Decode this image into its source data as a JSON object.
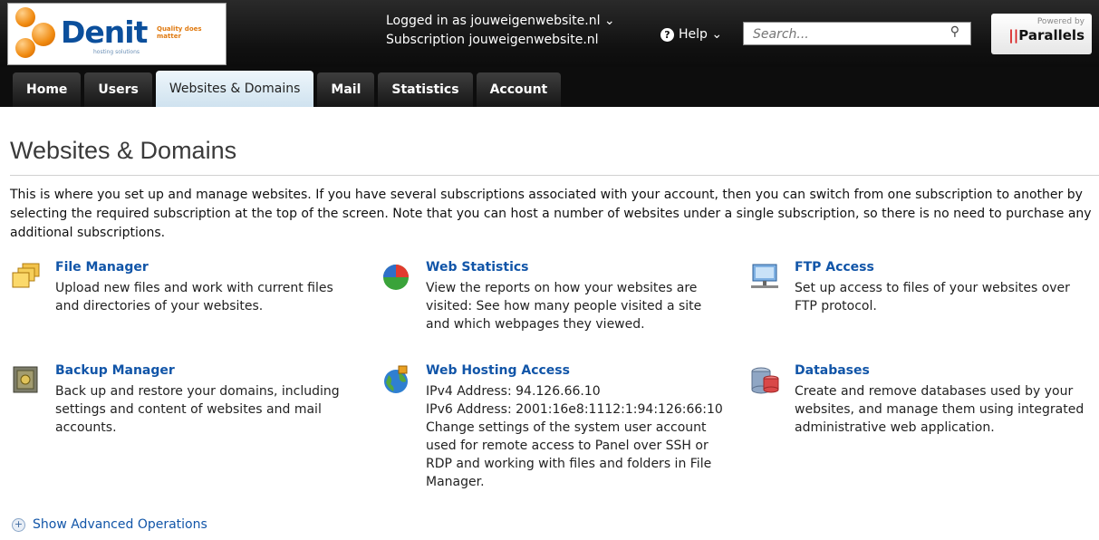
{
  "header": {
    "logo_text": "Denit",
    "logo_tagline": "Quality does matter",
    "logo_sub": "hosting solutions",
    "logged_in": "Logged in as jouweigenwebsite.nl ⌄",
    "subscription": "Subscription jouweigenwebsite.nl",
    "help_label": "Help ⌄",
    "search_placeholder": "Search...",
    "powered_by": "Powered by",
    "parallels": "Parallels"
  },
  "tabs": [
    {
      "label": "Home"
    },
    {
      "label": "Users"
    },
    {
      "label": "Websites & Domains",
      "active": true
    },
    {
      "label": "Mail"
    },
    {
      "label": "Statistics"
    },
    {
      "label": "Account"
    }
  ],
  "page": {
    "title": "Websites & Domains",
    "intro": "This is where you set up and manage websites. If you have several subscriptions associated with your account, then you can switch from one subscription to another by selecting the required subscription at the top of the screen. Note that you can host a number of websites under a single subscription, so there is no need to purchase any additional subscriptions."
  },
  "tools": {
    "file_manager": {
      "title": "File Manager",
      "desc": "Upload new files and work with current files and directories of your websites.",
      "icon": "folder-stack-icon"
    },
    "web_statistics": {
      "title": "Web Statistics",
      "desc": "View the reports on how your websites are visited: See how many people visited a site and which webpages they viewed.",
      "icon": "pie-chart-icon"
    },
    "ftp_access": {
      "title": "FTP Access",
      "desc": "Set up access to files of your websites over FTP protocol.",
      "icon": "ftp-icon"
    },
    "backup_manager": {
      "title": "Backup Manager",
      "desc": "Back up and restore your domains, including settings and content of websites and mail accounts.",
      "icon": "safe-icon"
    },
    "web_hosting_access": {
      "title": "Web Hosting Access",
      "ipv4": "IPv4 Address: 94.126.66.10",
      "ipv6": "IPv6 Address: 2001:16e8:1112:1:94:126:66:10",
      "desc": "Change settings of the system user account used for remote access to Panel over SSH or RDP and working with files and folders in File Manager.",
      "icon": "globe-icon"
    },
    "databases": {
      "title": "Databases",
      "desc": "Create and remove databases used by your websites, and manage them using integrated administrative web application.",
      "icon": "database-icon"
    }
  },
  "advanced": {
    "label": "Show Advanced Operations"
  },
  "colors": {
    "link": "#1155a8",
    "topbar": "#0d0d0d",
    "active_tab": "#dcebf5"
  }
}
